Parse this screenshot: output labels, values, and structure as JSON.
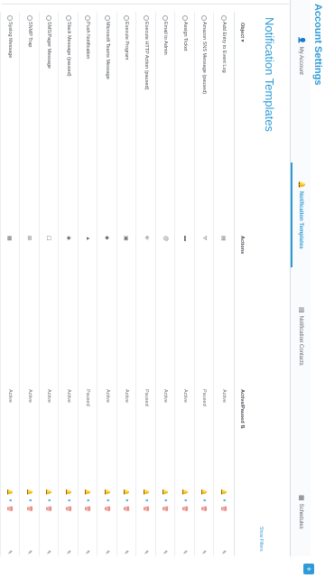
{
  "app_title": "Account Settings",
  "tabs": [
    {
      "label": "My Account",
      "icon": "user-icon"
    },
    {
      "label": "Notification Templates",
      "icon": "bell-icon"
    },
    {
      "label": "Notification Contacts",
      "icon": "contacts-icon"
    },
    {
      "label": "Schedules",
      "icon": "calendar-icon"
    }
  ],
  "page_title": "Notification Templates",
  "show_filters": "Show Filters",
  "table": {
    "headers": {
      "object": "Object ▾",
      "actions": "Actions",
      "status": "Active/Paused ⇅"
    },
    "rows": [
      {
        "object": "Add Entry to Event Log",
        "icon": "▤",
        "status": "Active"
      },
      {
        "object": "Amazon SNS Message (paused)",
        "icon": "⛛",
        "status": "Paused"
      },
      {
        "object": "Assign Ticket",
        "icon": "▬",
        "status": "Active"
      },
      {
        "object": "Email to Admin",
        "icon": "@",
        "status": "Active"
      },
      {
        "object": "Execute HTTP Action (paused)",
        "icon": "⎆",
        "status": "Paused"
      },
      {
        "object": "Execute Program",
        "icon": "▣",
        "status": "Active"
      },
      {
        "object": "Microsoft Teams Message",
        "icon": "◆",
        "status": "Active"
      },
      {
        "object": "Push Notification",
        "icon": "▲",
        "status": "Paused"
      },
      {
        "object": "Slack Message (paused)",
        "icon": "✱",
        "status": "Active"
      },
      {
        "object": "SMS/Pager Message",
        "icon": "☐",
        "status": "Active"
      },
      {
        "object": "SNMP Trap",
        "icon": "⊞",
        "status": "Active"
      },
      {
        "object": "Syslog Message",
        "icon": "▦",
        "status": "Active"
      }
    ]
  },
  "add_button": "+"
}
